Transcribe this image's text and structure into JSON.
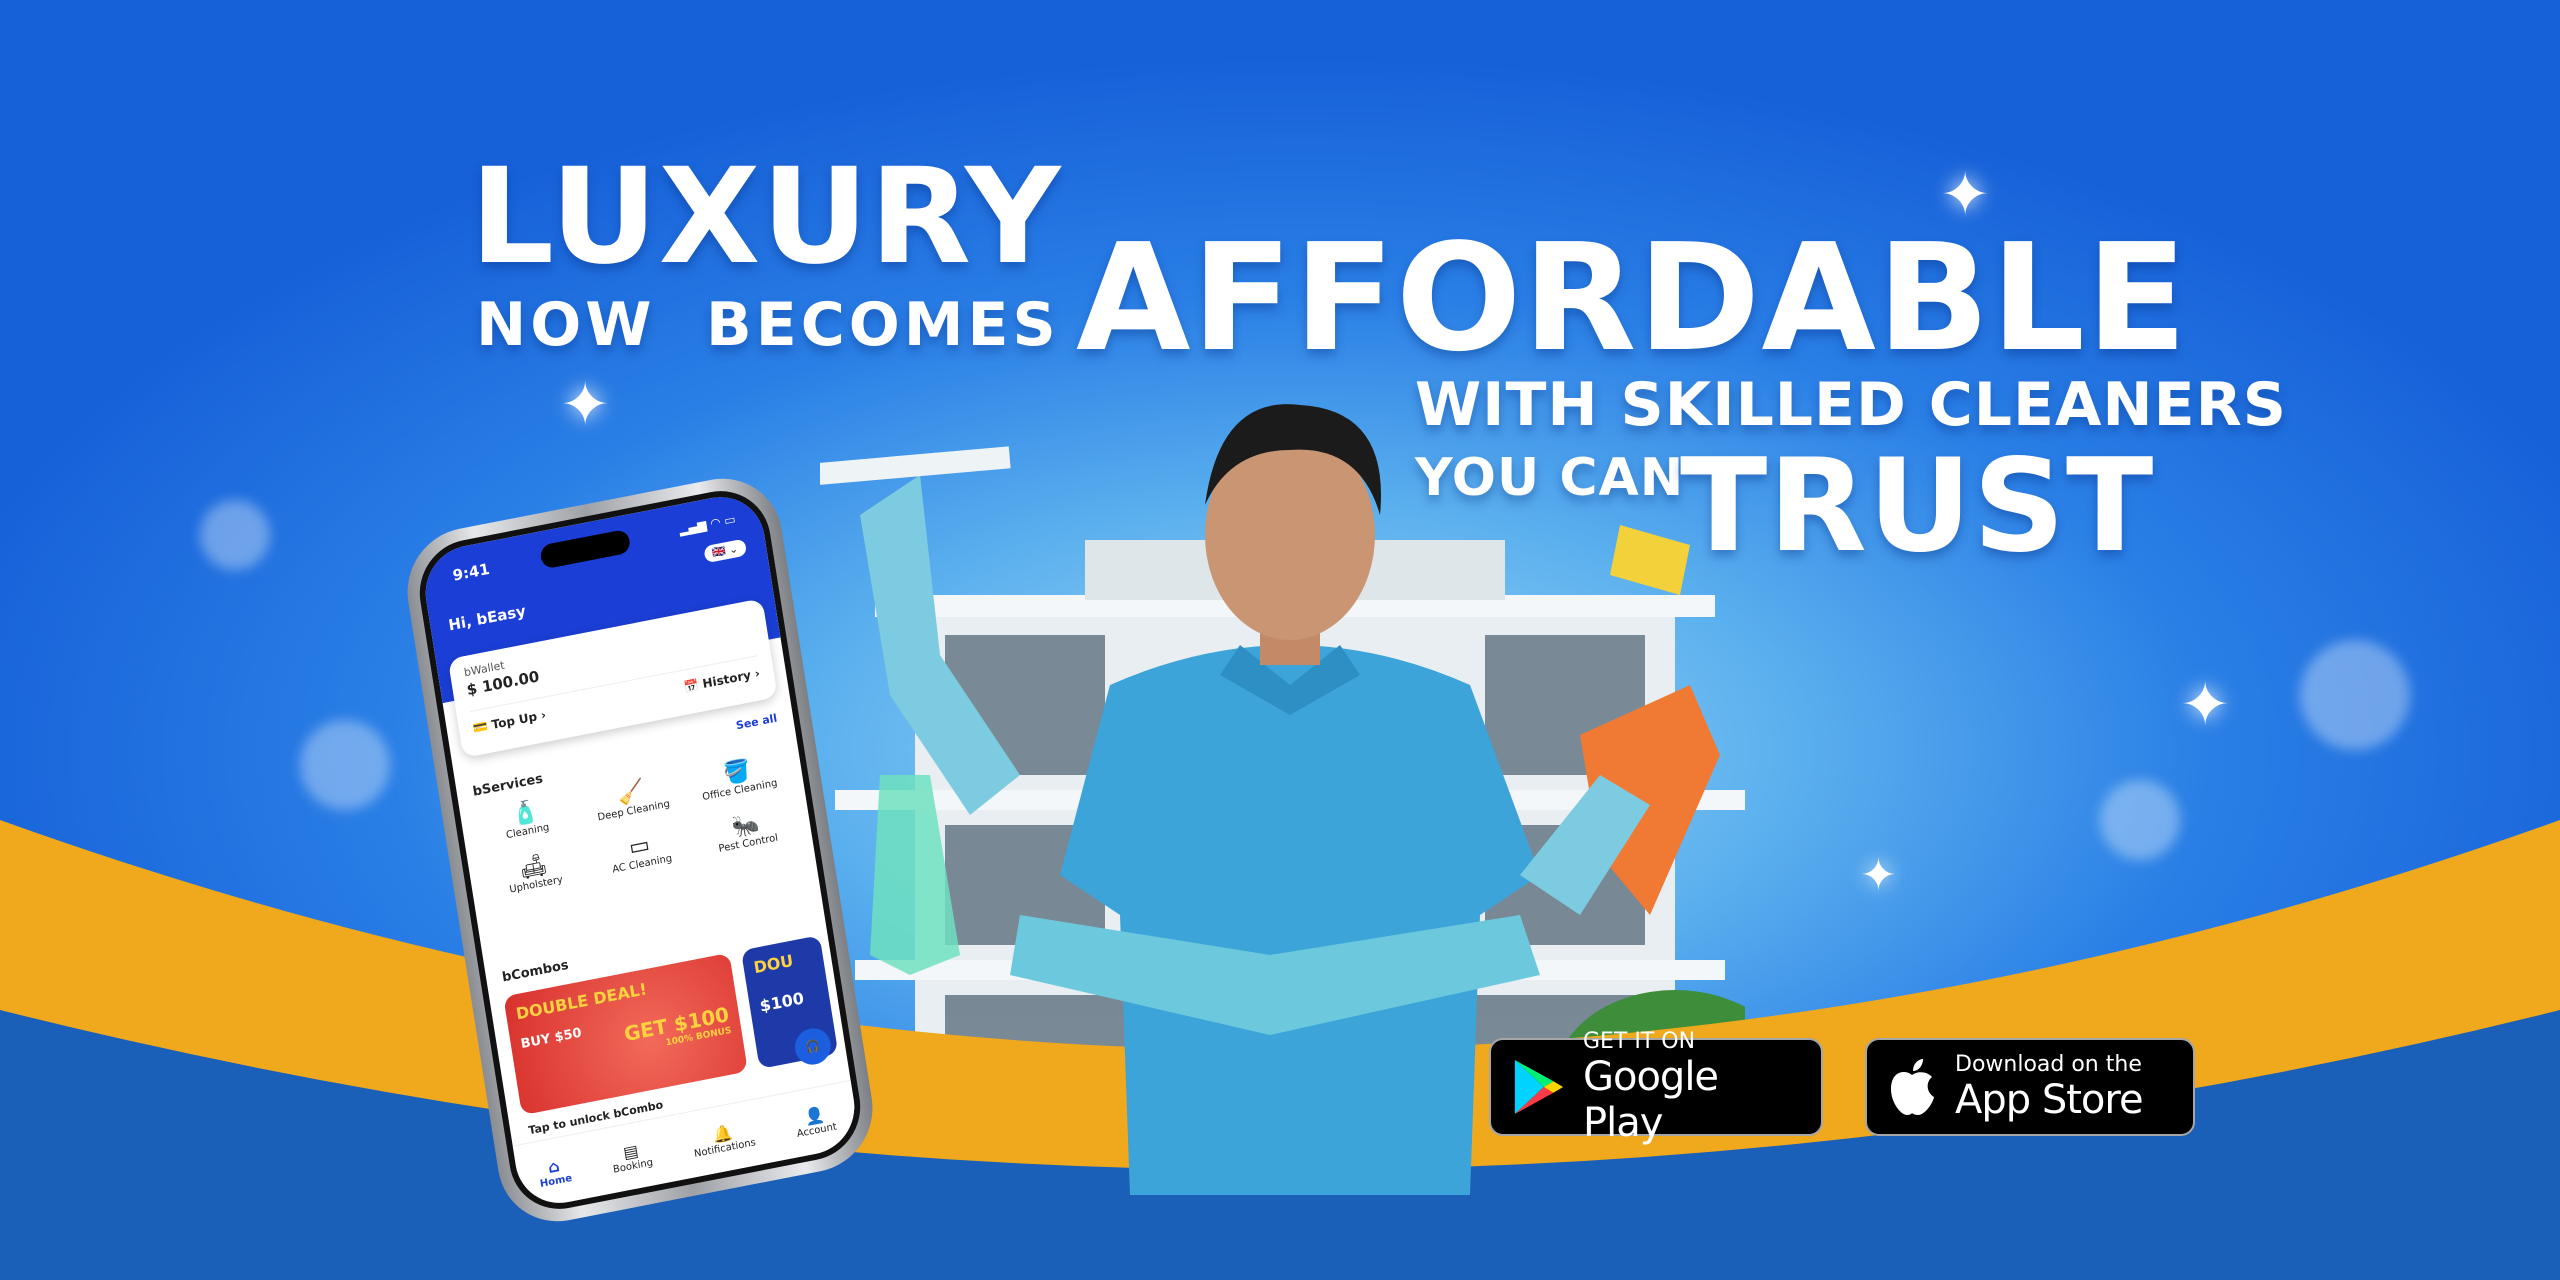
{
  "headline": {
    "line1": "LUXURY",
    "line2a": "NOW",
    "line2b": "BECOMES",
    "line3": "AFFORDABLE",
    "line4": "WITH SKILLED CLEANERS",
    "line5a": "YOU CAN",
    "line5b": "TRUST"
  },
  "stores": {
    "google": {
      "small": "GET IT ON",
      "big": "Google Play"
    },
    "apple": {
      "small": "Download on the",
      "big": "App Store"
    }
  },
  "phone": {
    "time": "9:41",
    "greeting": "Hi, bEasy",
    "wallet": {
      "label": "bWallet",
      "amount": "$ 100.00",
      "top_up": "Top Up",
      "history": "History"
    },
    "see_all": "See all",
    "services_title": "bServices",
    "services": [
      {
        "label": "Cleaning"
      },
      {
        "label": "Deep Cleaning"
      },
      {
        "label": "Office Cleaning"
      },
      {
        "label": "Upholstery"
      },
      {
        "label": "AC Cleaning"
      },
      {
        "label": "Pest Control"
      }
    ],
    "combos_title": "bCombos",
    "combo": {
      "title": "DOUBLE DEAL!",
      "buy": "BUY $50",
      "get": "GET $100",
      "bonus": "100% BONUS",
      "tap": "Tap to unlock bCombo"
    },
    "combo2": {
      "title": "DOU",
      "buy": "$100"
    },
    "nav": [
      {
        "label": "Home",
        "icon": "home-icon"
      },
      {
        "label": "Booking",
        "icon": "booking-icon"
      },
      {
        "label": "Notifications",
        "icon": "bell-icon"
      },
      {
        "label": "Account",
        "icon": "user-icon"
      }
    ]
  },
  "colors": {
    "brand_blue": "#1b3fd6",
    "accent_orange": "#f0a81c",
    "bottom_blue": "#1a5fb8"
  }
}
